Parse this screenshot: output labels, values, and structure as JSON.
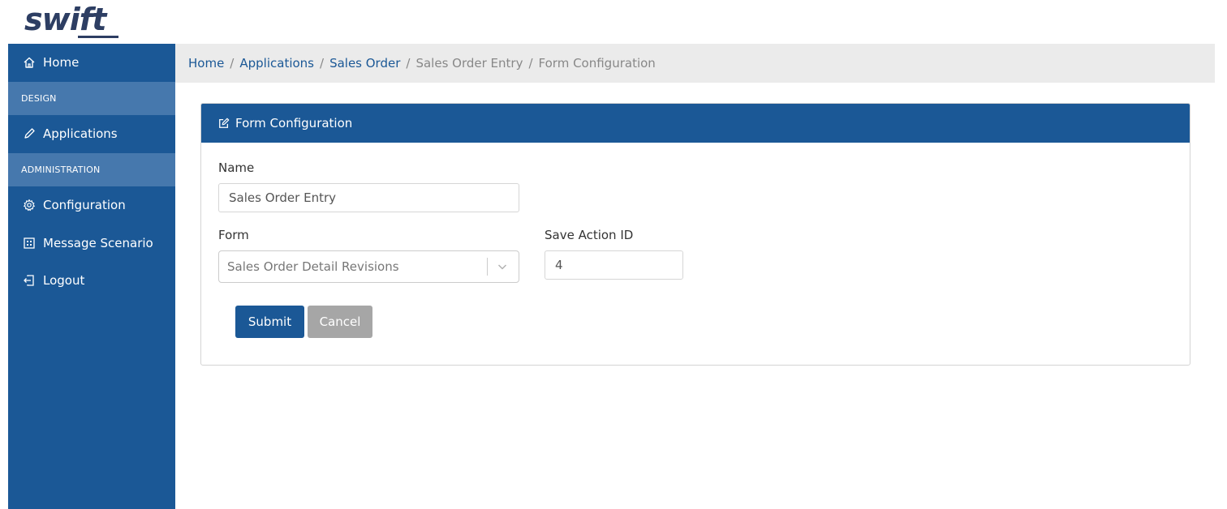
{
  "app": {
    "logo_text": "swift"
  },
  "sidebar": {
    "home_label": "Home",
    "section_design": "DESIGN",
    "applications_label": "Applications",
    "section_administration": "ADMINISTRATION",
    "configuration_label": "Configuration",
    "message_scenario_label": "Message Scenario",
    "logout_label": "Logout"
  },
  "breadcrumb": {
    "items": [
      "Home",
      "Applications",
      "Sales Order",
      "Sales Order Entry",
      "Form Configuration"
    ],
    "separator": "/"
  },
  "panel": {
    "title": "Form Configuration",
    "name_label": "Name",
    "name_value": "Sales Order Entry",
    "form_label": "Form",
    "form_selected": "Sales Order Detail Revisions",
    "save_action_label": "Save Action ID",
    "save_action_value": "4",
    "submit_label": "Submit",
    "cancel_label": "Cancel"
  },
  "colors": {
    "primary": "#1b5896",
    "sidebar_section": "#4678ad",
    "breadcrumb_bg": "#ebebeb",
    "cancel": "#a6a6a6"
  },
  "icons": {
    "home": "home-icon",
    "applications": "pencil-icon",
    "configuration": "gear-icon",
    "message_scenario": "grid-icon",
    "logout": "logout-icon",
    "panel": "edit-icon",
    "select": "chevron-down-icon"
  }
}
